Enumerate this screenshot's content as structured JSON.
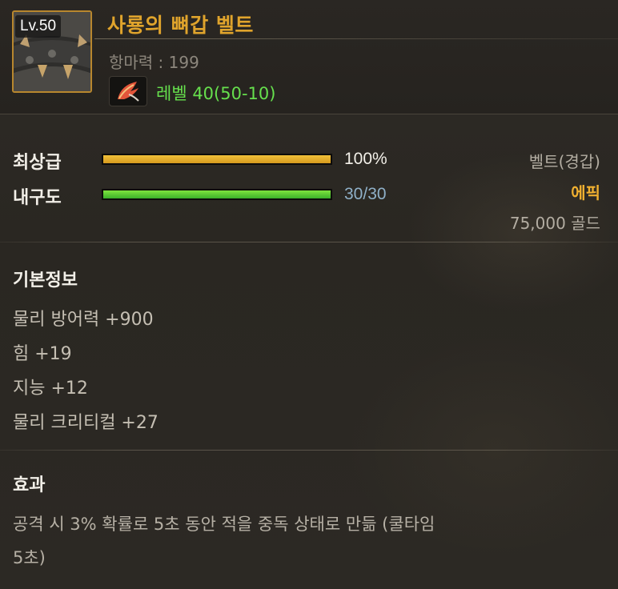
{
  "item": {
    "level_badge": "Lv.50",
    "name": "사룡의 뼈갑 벨트",
    "magic_resistance": "항마력 : 199",
    "level_requirement": "레벨 40(50-10)",
    "icon": "bone-belt-icon",
    "level_icon": "feather-quill-icon"
  },
  "stats": {
    "grade_label": "최상급",
    "grade_value": "100%",
    "grade_fraction": 1.0,
    "durability_label": "내구도",
    "durability_value": "30/30",
    "durability_fraction": 1.0
  },
  "info": {
    "type": "벨트(경갑)",
    "rarity": "에픽",
    "price": "75,000 골드"
  },
  "basic": {
    "title": "기본정보",
    "lines": [
      "물리 방어력 +900",
      "힘 +19",
      "지능 +12",
      "물리 크리티컬 +27"
    ]
  },
  "effect": {
    "title": "효과",
    "line1": "공격 시 3% 확률로 5초 동안 적을 중독 상태로 만듦 (쿨타임",
    "line2": "5초)"
  },
  "colors": {
    "name": "#e0a42c",
    "rarity_epic": "#f0b030",
    "level_req": "#66e04d",
    "durability_text": "#8fb0c8",
    "grade_bar": "#e2ad2c",
    "durability_bar": "#55c834"
  }
}
